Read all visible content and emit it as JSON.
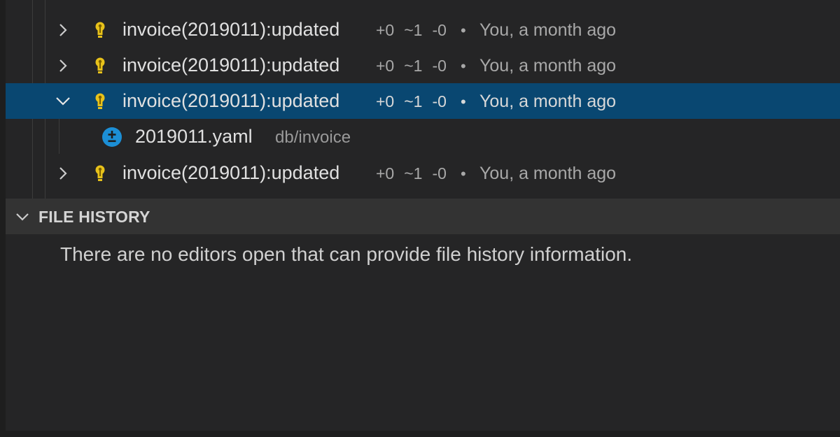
{
  "commits": [
    {
      "label": "invoice(2019011):updated",
      "changes": {
        "added": "+0",
        "modified": "~1",
        "deleted": "-0"
      },
      "separator": "•",
      "who": "You, a month ago",
      "expanded": false,
      "selected": false
    },
    {
      "label": "invoice(2019011):updated",
      "changes": {
        "added": "+0",
        "modified": "~1",
        "deleted": "-0"
      },
      "separator": "•",
      "who": "You, a month ago",
      "expanded": false,
      "selected": false
    },
    {
      "label": "invoice(2019011):updated",
      "changes": {
        "added": "+0",
        "modified": "~1",
        "deleted": "-0"
      },
      "separator": "•",
      "who": "You, a month ago",
      "expanded": true,
      "selected": true
    },
    {
      "label": "invoice(2019011):updated",
      "changes": {
        "added": "+0",
        "modified": "~1",
        "deleted": "-0"
      },
      "separator": "•",
      "who": "You, a month ago",
      "expanded": false,
      "selected": false
    }
  ],
  "expanded_file": {
    "name": "2019011.yaml",
    "path": "db/invoice",
    "icon": "modified-file-icon"
  },
  "file_history": {
    "title": "FILE HISTORY",
    "empty_message": "There are no editors open that can provide file history information."
  },
  "colors": {
    "selection": "#094771",
    "commit_icon": "#e8c21a",
    "file_badge": "#1c8fd6"
  }
}
